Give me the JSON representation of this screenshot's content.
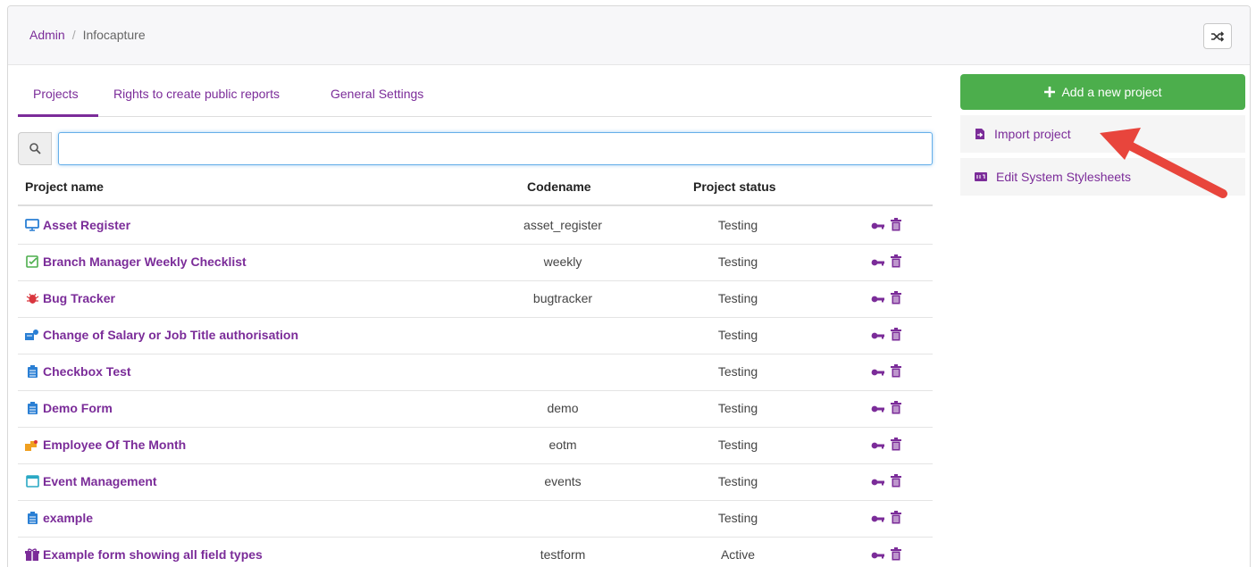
{
  "breadcrumb": {
    "root": "Admin",
    "separator": "/",
    "current": "Infocapture"
  },
  "tabs": [
    {
      "label": "Projects",
      "active": true
    },
    {
      "label": "Rights to create public reports",
      "active": false
    },
    {
      "label": "General Settings",
      "active": false
    }
  ],
  "search": {
    "value": "",
    "placeholder": ""
  },
  "table": {
    "headers": {
      "name": "Project name",
      "codename": "Codename",
      "status": "Project status"
    },
    "rows": [
      {
        "name": "Asset Register",
        "codename": "asset_register",
        "status": "Testing",
        "icon": "monitor-icon"
      },
      {
        "name": "Branch Manager Weekly Checklist",
        "codename": "weekly",
        "status": "Testing",
        "icon": "checklist-icon"
      },
      {
        "name": "Bug Tracker",
        "codename": "bugtracker",
        "status": "Testing",
        "icon": "bug-icon"
      },
      {
        "name": "Change of Salary or Job Title authorisation",
        "codename": "",
        "status": "Testing",
        "icon": "salary-icon"
      },
      {
        "name": "Checkbox Test",
        "codename": "",
        "status": "Testing",
        "icon": "form-icon"
      },
      {
        "name": "Demo Form",
        "codename": "demo",
        "status": "Testing",
        "icon": "form-icon"
      },
      {
        "name": "Employee Of The Month",
        "codename": "eotm",
        "status": "Testing",
        "icon": "award-icon"
      },
      {
        "name": "Event Management",
        "codename": "events",
        "status": "Testing",
        "icon": "calendar-icon"
      },
      {
        "name": "example",
        "codename": "",
        "status": "Testing",
        "icon": "form-icon"
      },
      {
        "name": "Example form showing all field types",
        "codename": "testform",
        "status": "Active",
        "icon": "gift-icon"
      }
    ]
  },
  "sidebar": {
    "add_label": "Add a new project",
    "import_label": "Import project",
    "stylesheets_label": "Edit System Stylesheets"
  },
  "colors": {
    "accent": "#7b2c99",
    "success": "#4cae4c",
    "annotation_arrow": "#e8453c"
  }
}
